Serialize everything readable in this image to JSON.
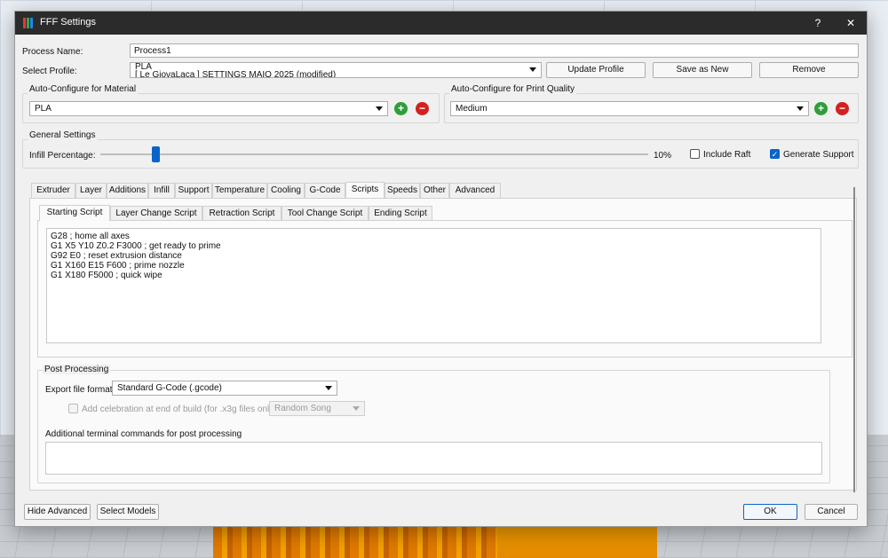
{
  "window": {
    "title": "FFF Settings",
    "help_symbol": "?",
    "close_symbol": "✕",
    "icon_name": "simplify3d-app-icon"
  },
  "process": {
    "name_label": "Process Name:",
    "name_value": "Process1",
    "profile_label": "Select Profile:",
    "profile_value_line1": "PLA",
    "profile_value_line2": "[ Le GiovaLaca ] SETTINGS MAIO 2025 (modified)",
    "update_profile": "Update Profile",
    "save_as_new": "Save as New",
    "remove": "Remove"
  },
  "material": {
    "title": "Auto-Configure for Material",
    "value": "PLA"
  },
  "quality": {
    "title": "Auto-Configure for Print Quality",
    "value": "Medium"
  },
  "general": {
    "title": "General Settings",
    "infill_label": "Infill Percentage:",
    "infill_percent": 10,
    "infill_text": "10%",
    "include_raft": "Include Raft",
    "include_raft_checked": false,
    "generate_support": "Generate Support",
    "generate_support_checked": true
  },
  "tabs": [
    {
      "label": "Extruder"
    },
    {
      "label": "Layer"
    },
    {
      "label": "Additions"
    },
    {
      "label": "Infill"
    },
    {
      "label": "Support"
    },
    {
      "label": "Temperature"
    },
    {
      "label": "Cooling"
    },
    {
      "label": "G-Code"
    },
    {
      "label": "Scripts"
    },
    {
      "label": "Speeds"
    },
    {
      "label": "Other"
    },
    {
      "label": "Advanced"
    }
  ],
  "active_tab": "Scripts",
  "subtabs": [
    {
      "label": "Starting Script"
    },
    {
      "label": "Layer Change Script"
    },
    {
      "label": "Retraction Script"
    },
    {
      "label": "Tool Change Script"
    },
    {
      "label": "Ending Script"
    }
  ],
  "active_subtab": "Starting Script",
  "starting_script": "G28 ; home all axes\nG1 X5 Y10 Z0.2 F3000 ; get ready to prime\nG92 E0 ; reset extrusion distance\nG1 X160 E15 F600 ; prime nozzle\nG1 X180 F5000 ; quick wipe",
  "post_processing": {
    "title": "Post Processing",
    "export_label": "Export file format",
    "export_value": "Standard G-Code (.gcode)",
    "celebration_label": "Add celebration at end of build (for .x3g files only)",
    "celebration_checked": false,
    "song_value": "Random Song",
    "terminal_label": "Additional terminal commands for post processing",
    "terminal_value": ""
  },
  "footer": {
    "hide_advanced": "Hide Advanced",
    "select_models": "Select Models",
    "ok": "OK",
    "cancel": "Cancel"
  },
  "colors": {
    "accent": "#0a64c8",
    "add_green": "#2e9e3a",
    "remove_red": "#d32020",
    "titlebar": "#2b2b2b"
  }
}
